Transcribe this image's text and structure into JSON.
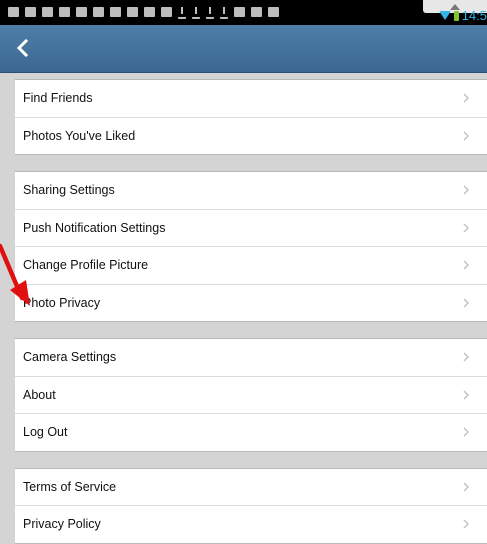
{
  "status_bar": {
    "time": "14:5",
    "icons": [
      "notification-icon",
      "notification-icon",
      "notification-icon",
      "notification-icon",
      "notification-icon",
      "notification-icon",
      "notification-icon",
      "notification-icon",
      "mail-icon",
      "mail-icon",
      "download-icon",
      "download-icon",
      "download-icon",
      "download-icon",
      "image-icon",
      "notification-icon",
      "notification-icon"
    ]
  },
  "menu": {
    "groups": [
      {
        "items": [
          "Find Friends",
          "Photos You've Liked"
        ]
      },
      {
        "items": [
          "Sharing Settings",
          "Push Notification Settings",
          "Change Profile Picture",
          "Photo Privacy"
        ]
      },
      {
        "items": [
          "Camera Settings",
          "About",
          "Log Out"
        ]
      },
      {
        "items": [
          "Terms of Service",
          "Privacy Policy"
        ]
      }
    ]
  },
  "colors": {
    "action_bar": "#3f6d98",
    "annotation_arrow": "#e01010",
    "clock": "#33b5e5"
  }
}
